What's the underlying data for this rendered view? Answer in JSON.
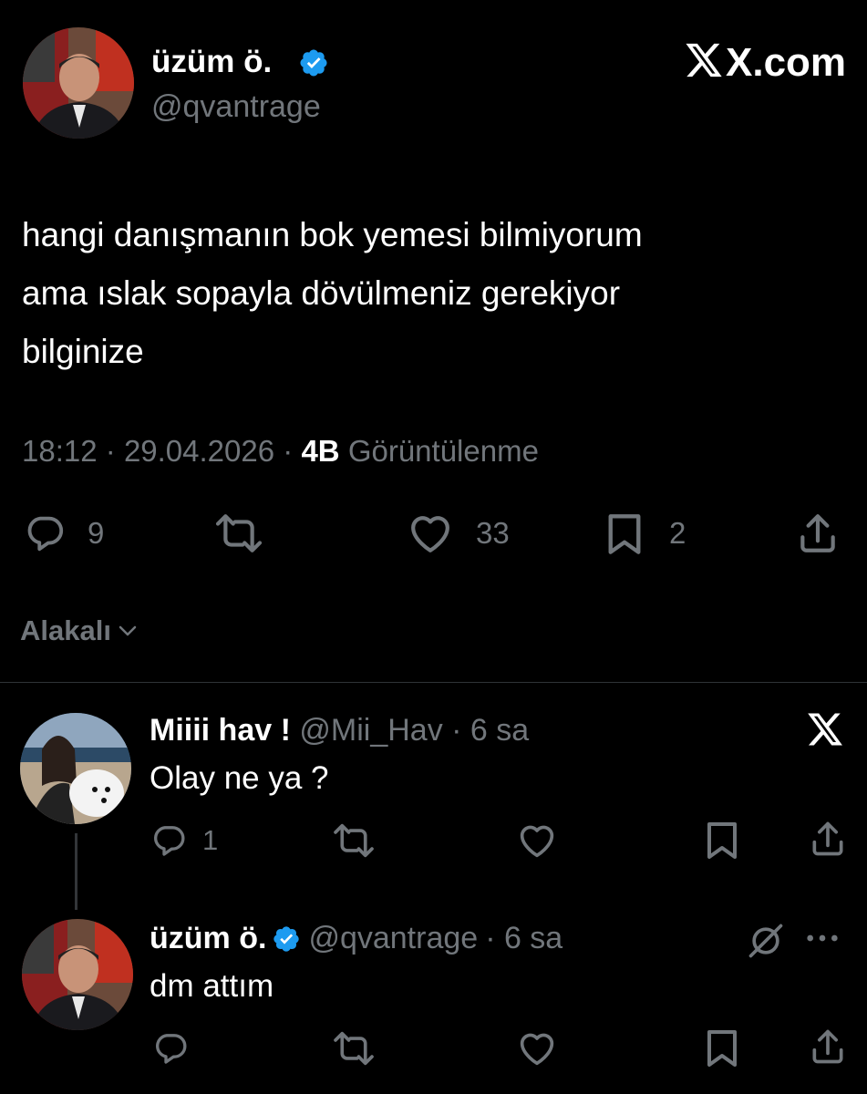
{
  "main_tweet": {
    "author_name": "üzüm ö.",
    "author_handle": "@qvantrage",
    "site_label": "X.com",
    "text_lines": [
      "hangi danışmanın bok yemesi bilmiyorum",
      "ama ıslak sopayla dövülmeniz gerekiyor",
      "bilginize"
    ],
    "time": "18:12",
    "separator": "·",
    "date": "29.04.2026",
    "views_count": "4B",
    "views_label": "Görüntülenme",
    "replies": "9",
    "likes": "33",
    "bookmarks": "2"
  },
  "sort": {
    "label": "Alakalı"
  },
  "replies": [
    {
      "author_name": "Miiii hav !",
      "author_handle": "@Mii_Hav",
      "time": "· 6 sa",
      "text": "Olay ne ya ?",
      "reply_count": "1"
    },
    {
      "author_name": "üzüm ö.",
      "author_handle": "@qvantrage",
      "time": "· 6 sa",
      "text": "dm attım"
    }
  ],
  "colors": {
    "background": "#000000",
    "verified_badge": "#1d9bf0",
    "secondary_text": "#71767b",
    "divider": "#2f3336"
  },
  "icons": [
    "verified-badge",
    "x-logo",
    "reply-icon",
    "retweet-icon",
    "like-icon",
    "bookmark-icon",
    "share-icon",
    "chevron-down-icon",
    "grok-icon",
    "more-icon"
  ]
}
